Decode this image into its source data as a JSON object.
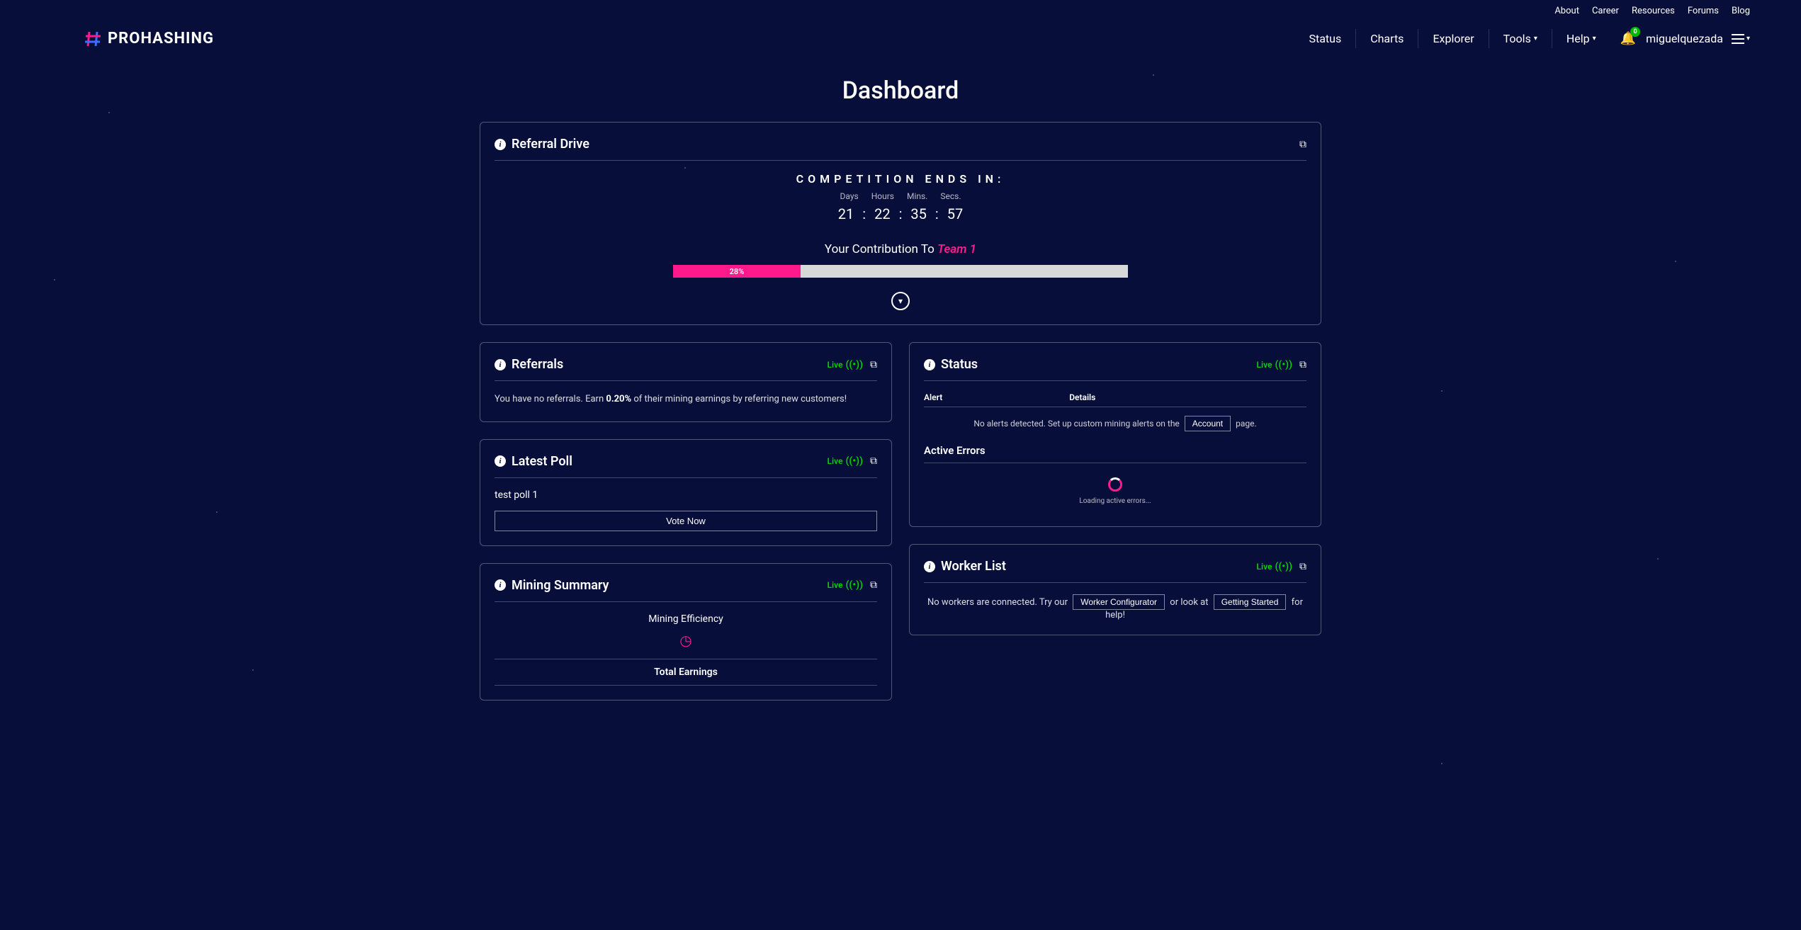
{
  "topNav": {
    "about": "About",
    "career": "Career",
    "resources": "Resources",
    "forums": "Forums",
    "blog": "Blog"
  },
  "logo": {
    "text": "PROHASHING"
  },
  "mainNav": {
    "status": "Status",
    "charts": "Charts",
    "explorer": "Explorer",
    "tools": "Tools",
    "help": "Help"
  },
  "notifications": {
    "count": "0"
  },
  "user": {
    "name": "miguelquezada"
  },
  "pageTitle": "Dashboard",
  "referralDrive": {
    "title": "Referral Drive",
    "competitionLabel": "COMPETITION ENDS IN:",
    "labels": {
      "days": "Days",
      "hours": "Hours",
      "mins": "Mins.",
      "secs": "Secs."
    },
    "countdown": {
      "days": "21",
      "hours": "22",
      "mins": "35",
      "secs": "57"
    },
    "contributionPrefix": "Your Contribution To ",
    "teamName": "Team 1",
    "progressPct": "28%"
  },
  "referrals": {
    "title": "Referrals",
    "live": "Live",
    "textPrefix": "You have no referrals. Earn ",
    "pct": "0.20%",
    "textSuffix": " of their mining earnings by referring new customers!"
  },
  "poll": {
    "title": "Latest Poll",
    "live": "Live",
    "name": "test poll 1",
    "voteBtn": "Vote Now"
  },
  "status": {
    "title": "Status",
    "live": "Live",
    "colAlert": "Alert",
    "colDetails": "Details",
    "noAlertsPrefix": "No alerts detected. Set up custom mining alerts on the ",
    "accountBtn": "Account",
    "noAlertsSuffix": " page.",
    "activeErrors": "Active Errors",
    "loadingText": "Loading active errors..."
  },
  "mining": {
    "title": "Mining Summary",
    "live": "Live",
    "efficiency": "Mining Efficiency",
    "totalEarnings": "Total Earnings"
  },
  "workers": {
    "title": "Worker List",
    "live": "Live",
    "textPrefix": "No workers are connected. Try our ",
    "configBtn": "Worker Configurator",
    "textMid": " or look at ",
    "startedBtn": "Getting Started",
    "textSuffix": " for help!"
  }
}
